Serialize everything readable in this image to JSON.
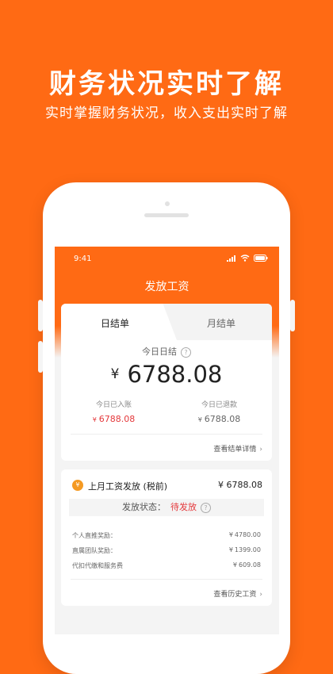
{
  "promo": {
    "headline": "财务状况实时了解",
    "subline": "实时掌握财务状况，收入支出实时了解"
  },
  "status_bar": {
    "time": "9:41"
  },
  "nav": {
    "title": "发放工资"
  },
  "settlement": {
    "tabs": [
      {
        "label": "日结单",
        "active": true
      },
      {
        "label": "月结单",
        "active": false
      }
    ],
    "today_label": "今日日结",
    "help_icon": "?",
    "currency": "¥",
    "today_amount": "6788.08",
    "credited": {
      "label": "今日已入账",
      "currency": "¥",
      "amount": "6788.08"
    },
    "refunded": {
      "label": "今日已退款",
      "currency": "¥",
      "amount": "6788.08"
    },
    "detail_link": "查看结单详情",
    "chevron": "›"
  },
  "salary": {
    "medal_icon": "¥",
    "title": "上月工资发放 (税前)",
    "amount": "¥ 6788.08",
    "status_label": "发放状态：",
    "status_value": "待发放",
    "items": [
      {
        "label": "个人直推奖励：",
        "currency": "¥",
        "value": "4780.00"
      },
      {
        "label": "直属团队奖励：",
        "currency": "¥",
        "value": "1399.00"
      },
      {
        "label": "代扣代缴和服务费",
        "currency": "¥",
        "value": "609.08"
      }
    ],
    "history_link": "查看历史工资"
  },
  "colors": {
    "brand": "#FF6A14",
    "accent_red": "#E4393C",
    "medal": "#F59A23"
  }
}
